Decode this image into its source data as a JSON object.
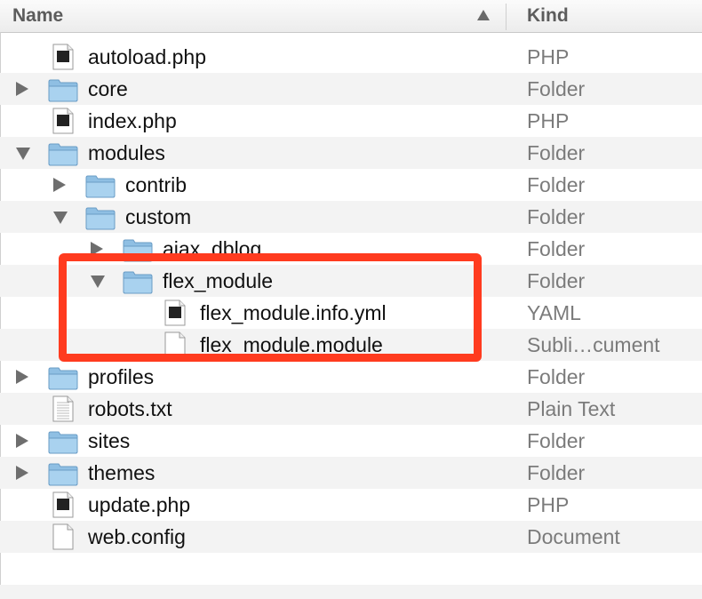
{
  "header": {
    "name_label": "Name",
    "kind_label": "Kind",
    "sort_icon": "sort-ascending-icon"
  },
  "colors": {
    "highlight": "#ff3b1f",
    "folder": "#9cc6e6",
    "kind_text": "#7b7b7b"
  },
  "rows": [
    {
      "name": "autoload.php",
      "kind": "PHP",
      "icon": "php-file-icon",
      "depth": 0,
      "disclosure": "none"
    },
    {
      "name": "core",
      "kind": "Folder",
      "icon": "folder-icon",
      "depth": 0,
      "disclosure": "closed"
    },
    {
      "name": "index.php",
      "kind": "PHP",
      "icon": "php-file-icon",
      "depth": 0,
      "disclosure": "none"
    },
    {
      "name": "modules",
      "kind": "Folder",
      "icon": "folder-icon",
      "depth": 0,
      "disclosure": "open"
    },
    {
      "name": "contrib",
      "kind": "Folder",
      "icon": "folder-icon",
      "depth": 1,
      "disclosure": "closed"
    },
    {
      "name": "custom",
      "kind": "Folder",
      "icon": "folder-icon",
      "depth": 1,
      "disclosure": "open"
    },
    {
      "name": "ajax_dblog",
      "kind": "Folder",
      "icon": "folder-icon",
      "depth": 2,
      "disclosure": "closed"
    },
    {
      "name": "flex_module",
      "kind": "Folder",
      "icon": "folder-icon",
      "depth": 2,
      "disclosure": "open"
    },
    {
      "name": "flex_module.info.yml",
      "kind": "YAML",
      "icon": "yaml-file-icon",
      "depth": 3,
      "disclosure": "none"
    },
    {
      "name": "flex_module.module",
      "kind": "Subli…cument",
      "icon": "document-icon",
      "depth": 3,
      "disclosure": "none"
    },
    {
      "name": "profiles",
      "kind": "Folder",
      "icon": "folder-icon",
      "depth": 0,
      "disclosure": "closed"
    },
    {
      "name": "robots.txt",
      "kind": "Plain Text",
      "icon": "text-file-icon",
      "depth": 0,
      "disclosure": "none"
    },
    {
      "name": "sites",
      "kind": "Folder",
      "icon": "folder-icon",
      "depth": 0,
      "disclosure": "closed"
    },
    {
      "name": "themes",
      "kind": "Folder",
      "icon": "folder-icon",
      "depth": 0,
      "disclosure": "closed"
    },
    {
      "name": "update.php",
      "kind": "PHP",
      "icon": "php-file-icon",
      "depth": 0,
      "disclosure": "none"
    },
    {
      "name": "web.config",
      "kind": "Document",
      "icon": "document-icon",
      "depth": 0,
      "disclosure": "none"
    }
  ]
}
